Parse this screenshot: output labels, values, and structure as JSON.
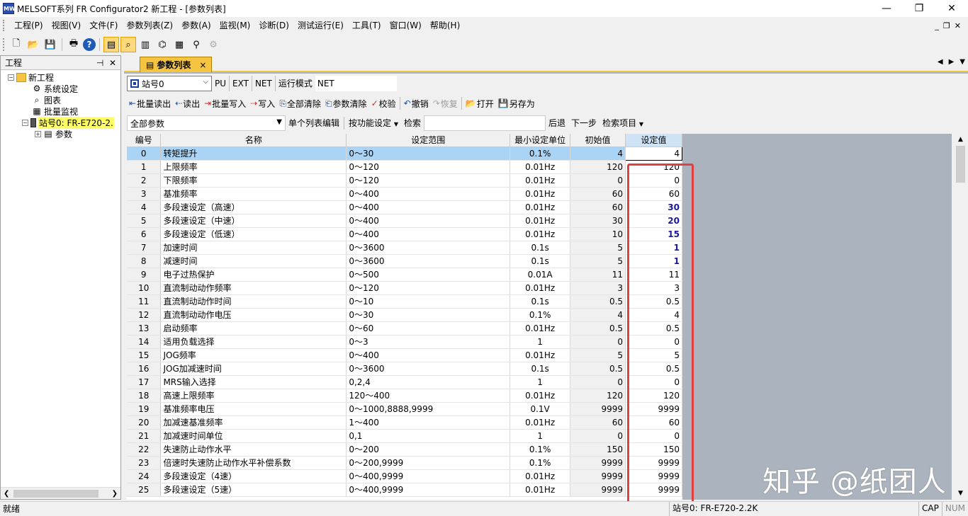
{
  "window": {
    "title": "MELSOFT系列 FR Configurator2 新工程 - [参数列表]",
    "app_icon_text": "MW"
  },
  "menu": [
    "工程(P)",
    "视图(V)",
    "文件(F)",
    "参数列表(Z)",
    "参数(A)",
    "监视(M)",
    "诊断(D)",
    "测试运行(E)",
    "工具(T)",
    "窗口(W)",
    "帮助(H)"
  ],
  "left_pane": {
    "title": "工程",
    "tree": {
      "root": "新工程",
      "system": "系统设定",
      "graph": "图表",
      "batch_monitor": "批量监视",
      "station": "站号0:  FR-E720-2.",
      "params": "参数"
    }
  },
  "doc_tab": {
    "label": "参数列表",
    "close": "×"
  },
  "toolbar1": {
    "station": "站号0",
    "pu": "PU",
    "ext": "EXT",
    "net": "NET",
    "mode_label": "运行模式",
    "mode_value": "NET"
  },
  "toolbar2": {
    "batch_read": "批量读出",
    "read": "读出",
    "batch_write": "批量写入",
    "write": "写入",
    "clear_all": "全部清除",
    "param_clear": "参数清除",
    "verify": "校验",
    "undo": "撤销",
    "redo": "恢复",
    "open": "打开",
    "save_as": "另存为"
  },
  "toolbar3": {
    "filter": "全部参数",
    "single_edit": "单个列表编辑",
    "by_function": "按功能设定",
    "search_label": "检索",
    "back": "后退",
    "next": "下一步",
    "search_item": "检索项目"
  },
  "table": {
    "headers": [
      "编号",
      "名称",
      "设定范围",
      "最小设定单位",
      "初始值",
      "设定值"
    ],
    "rows": [
      {
        "no": "0",
        "name": "转矩提升",
        "range": "0～30",
        "unit": "0.1%",
        "init": "4",
        "val": "4",
        "changed": false
      },
      {
        "no": "1",
        "name": "上限频率",
        "range": "0～120",
        "unit": "0.01Hz",
        "init": "120",
        "val": "120",
        "changed": false
      },
      {
        "no": "2",
        "name": "下限频率",
        "range": "0～120",
        "unit": "0.01Hz",
        "init": "0",
        "val": "0",
        "changed": false
      },
      {
        "no": "3",
        "name": "基准频率",
        "range": "0～400",
        "unit": "0.01Hz",
        "init": "60",
        "val": "60",
        "changed": false
      },
      {
        "no": "4",
        "name": "多段速设定（高速）",
        "range": "0～400",
        "unit": "0.01Hz",
        "init": "60",
        "val": "30",
        "changed": true
      },
      {
        "no": "5",
        "name": "多段速设定（中速）",
        "range": "0～400",
        "unit": "0.01Hz",
        "init": "30",
        "val": "20",
        "changed": true
      },
      {
        "no": "6",
        "name": "多段速设定（低速）",
        "range": "0～400",
        "unit": "0.01Hz",
        "init": "10",
        "val": "15",
        "changed": true
      },
      {
        "no": "7",
        "name": "加速时间",
        "range": "0～3600",
        "unit": "0.1s",
        "init": "5",
        "val": "1",
        "changed": true
      },
      {
        "no": "8",
        "name": "减速时间",
        "range": "0～3600",
        "unit": "0.1s",
        "init": "5",
        "val": "1",
        "changed": true
      },
      {
        "no": "9",
        "name": "电子过热保护",
        "range": "0～500",
        "unit": "0.01A",
        "init": "11",
        "val": "11",
        "changed": false
      },
      {
        "no": "10",
        "name": "直流制动动作频率",
        "range": "0～120",
        "unit": "0.01Hz",
        "init": "3",
        "val": "3",
        "changed": false
      },
      {
        "no": "11",
        "name": "直流制动动作时间",
        "range": "0～10",
        "unit": "0.1s",
        "init": "0.5",
        "val": "0.5",
        "changed": false
      },
      {
        "no": "12",
        "name": "直流制动动作电压",
        "range": "0～30",
        "unit": "0.1%",
        "init": "4",
        "val": "4",
        "changed": false
      },
      {
        "no": "13",
        "name": "启动频率",
        "range": "0～60",
        "unit": "0.01Hz",
        "init": "0.5",
        "val": "0.5",
        "changed": false
      },
      {
        "no": "14",
        "name": "适用负载选择",
        "range": "0～3",
        "unit": "1",
        "init": "0",
        "val": "0",
        "changed": false
      },
      {
        "no": "15",
        "name": "JOG频率",
        "range": "0～400",
        "unit": "0.01Hz",
        "init": "5",
        "val": "5",
        "changed": false
      },
      {
        "no": "16",
        "name": "JOG加减速时间",
        "range": "0～3600",
        "unit": "0.1s",
        "init": "0.5",
        "val": "0.5",
        "changed": false
      },
      {
        "no": "17",
        "name": "MRS输入选择",
        "range": "0,2,4",
        "unit": "1",
        "init": "0",
        "val": "0",
        "changed": false
      },
      {
        "no": "18",
        "name": "高速上限频率",
        "range": "120～400",
        "unit": "0.01Hz",
        "init": "120",
        "val": "120",
        "changed": false
      },
      {
        "no": "19",
        "name": "基准频率电压",
        "range": "0～1000,8888,9999",
        "unit": "0.1V",
        "init": "9999",
        "val": "9999",
        "changed": false
      },
      {
        "no": "20",
        "name": "加减速基准频率",
        "range": "1～400",
        "unit": "0.01Hz",
        "init": "60",
        "val": "60",
        "changed": false
      },
      {
        "no": "21",
        "name": "加减速时间单位",
        "range": "0,1",
        "unit": "1",
        "init": "0",
        "val": "0",
        "changed": false
      },
      {
        "no": "22",
        "name": "失速防止动作水平",
        "range": "0～200",
        "unit": "0.1%",
        "init": "150",
        "val": "150",
        "changed": false
      },
      {
        "no": "23",
        "name": "倍速时失速防止动作水平补偿系数",
        "range": "0～200,9999",
        "unit": "0.1%",
        "init": "9999",
        "val": "9999",
        "changed": false
      },
      {
        "no": "24",
        "name": "多段速设定（4速）",
        "range": "0～400,9999",
        "unit": "0.01Hz",
        "init": "9999",
        "val": "9999",
        "changed": false
      },
      {
        "no": "25",
        "name": "多段速设定（5速）",
        "range": "0～400,9999",
        "unit": "0.01Hz",
        "init": "9999",
        "val": "9999",
        "changed": false
      }
    ]
  },
  "watermark": "知乎 @纸团人",
  "status": {
    "left": "就绪",
    "station": "站号0:  FR-E720-2.2K",
    "cap": "CAP",
    "num": "NUM"
  },
  "colors": {
    "selected_row": "#aad4f5",
    "changed_value": "#1a1a9a",
    "highlight_box": "#e04040",
    "tab_accent": "#f5c542"
  }
}
